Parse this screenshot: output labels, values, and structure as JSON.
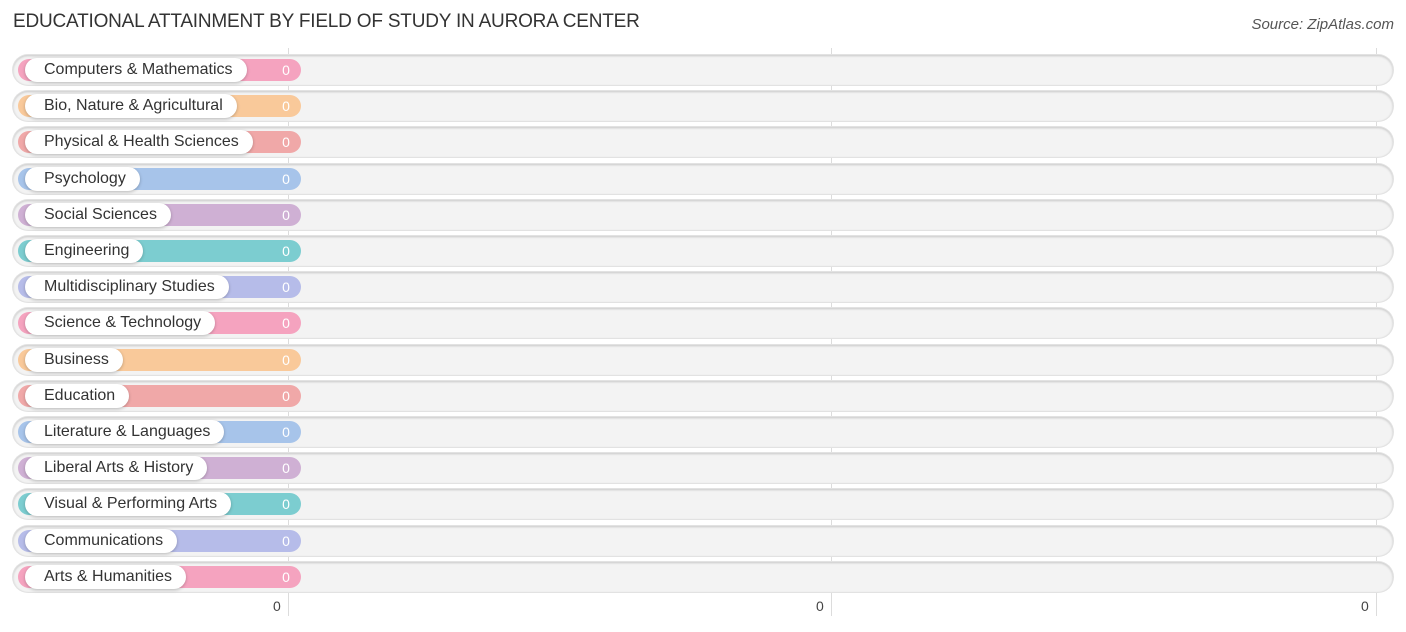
{
  "title": "EDUCATIONAL ATTAINMENT BY FIELD OF STUDY IN AURORA CENTER",
  "source": "Source: ZipAtlas.com",
  "chart_data": {
    "type": "bar",
    "orientation": "horizontal",
    "title": "EDUCATIONAL ATTAINMENT BY FIELD OF STUDY IN AURORA CENTER",
    "xlabel": "",
    "ylabel": "",
    "categories": [
      "Computers & Mathematics",
      "Bio, Nature & Agricultural",
      "Physical & Health Sciences",
      "Psychology",
      "Social Sciences",
      "Engineering",
      "Multidisciplinary Studies",
      "Science & Technology",
      "Business",
      "Education",
      "Literature & Languages",
      "Liberal Arts & History",
      "Visual & Performing Arts",
      "Communications",
      "Arts & Humanities"
    ],
    "values": [
      0,
      0,
      0,
      0,
      0,
      0,
      0,
      0,
      0,
      0,
      0,
      0,
      0,
      0,
      0
    ],
    "value_labels": [
      "0",
      "0",
      "0",
      "0",
      "0",
      "0",
      "0",
      "0",
      "0",
      "0",
      "0",
      "0",
      "0",
      "0",
      "0"
    ],
    "colors": [
      "#f5a3bf",
      "#f9c99a",
      "#f0a8a8",
      "#a7c4ea",
      "#cfb0d4",
      "#7ccdd0",
      "#b6bce9",
      "#f5a3bf",
      "#f9c99a",
      "#f0a8a8",
      "#a7c4ea",
      "#cfb0d4",
      "#7ccdd0",
      "#b6bce9",
      "#f5a3bf"
    ],
    "x_ticks": [
      "0",
      "0",
      "0"
    ],
    "grid": true,
    "legend": "none"
  }
}
